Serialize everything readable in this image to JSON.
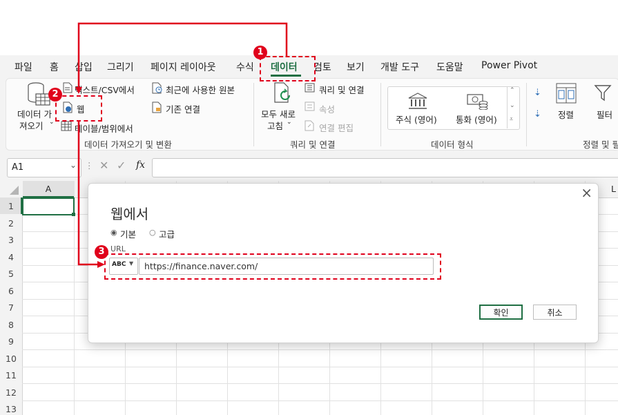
{
  "menu": {
    "tabs": [
      "파일",
      "홈",
      "삽입",
      "그리기",
      "페이지 레이아웃",
      "수식",
      "데이터",
      "검토",
      "보기",
      "개발 도구",
      "도움말",
      "Power Pivot"
    ],
    "active_tab": "데이터"
  },
  "ribbon": {
    "get_data": {
      "label_line1": "데이터 가",
      "label_line2": "져오기"
    },
    "text_csv": "텍스트/CSV에서",
    "web": "웹",
    "table_range": "테이블/범위에서",
    "recent_sources": "최근에 사용한 원본",
    "existing_connections": "기존 연결",
    "group_get_transform": "데이터 가져오기 및 변환",
    "refresh_all": {
      "line1": "모두 새로",
      "line2": "고침"
    },
    "queries_connections": "쿼리 및 연결",
    "properties": "속성",
    "edit_links": "연결 편집",
    "group_queries": "쿼리 및 연결",
    "stocks": "주식 (영어)",
    "currencies": "통화 (영어)",
    "group_data_types": "데이터 형식",
    "sort": "정렬",
    "filter": "필터",
    "group_sort_filter": "정렬 및 필"
  },
  "formula_bar": {
    "name_box": "A1",
    "fx": "fx",
    "value": ""
  },
  "grid": {
    "columns": [
      "A"
    ],
    "rows": [
      "1",
      "2",
      "3",
      "4",
      "5",
      "6",
      "7",
      "8",
      "9",
      "10",
      "11",
      "12",
      "13"
    ],
    "right_edge_col": "L"
  },
  "dialog": {
    "title": "웹에서",
    "radio_basic": "기본",
    "radio_advanced": "고급",
    "url_label": "URL",
    "type_badge": "ABC",
    "url_value": "https://finance.naver.com/",
    "ok": "확인",
    "cancel": "취소",
    "close": "×"
  },
  "callouts": [
    "1",
    "2",
    "3"
  ],
  "colors": {
    "excel_green": "#1f6f43",
    "callout_red": "#e0001b"
  }
}
